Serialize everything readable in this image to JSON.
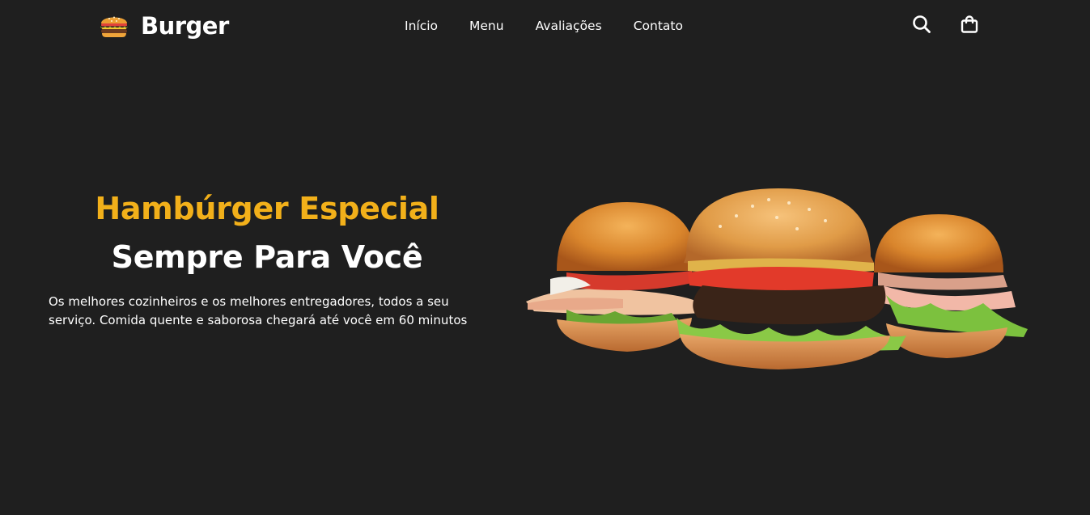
{
  "brand": {
    "name": "Burger",
    "logo_icon": "burger-emoji-icon"
  },
  "nav": {
    "items": [
      {
        "label": "Início"
      },
      {
        "label": "Menu"
      },
      {
        "label": "Avaliações"
      },
      {
        "label": "Contato"
      }
    ]
  },
  "header_icons": {
    "search": "search-icon",
    "cart": "shopping-bag-icon"
  },
  "hero": {
    "title": "Hambúrger Especial",
    "subtitle": "Sempre Para Você",
    "description_line1": "Os melhores cozinheiros e os melhores entregadores, todos a seu",
    "description_line2": "serviço. Comida quente e saborosa chegará até você em 60 minutos",
    "image": "three-burgers-image"
  },
  "colors": {
    "background": "#1f1f1f",
    "accent": "#f2b01a",
    "text": "#ffffff"
  }
}
